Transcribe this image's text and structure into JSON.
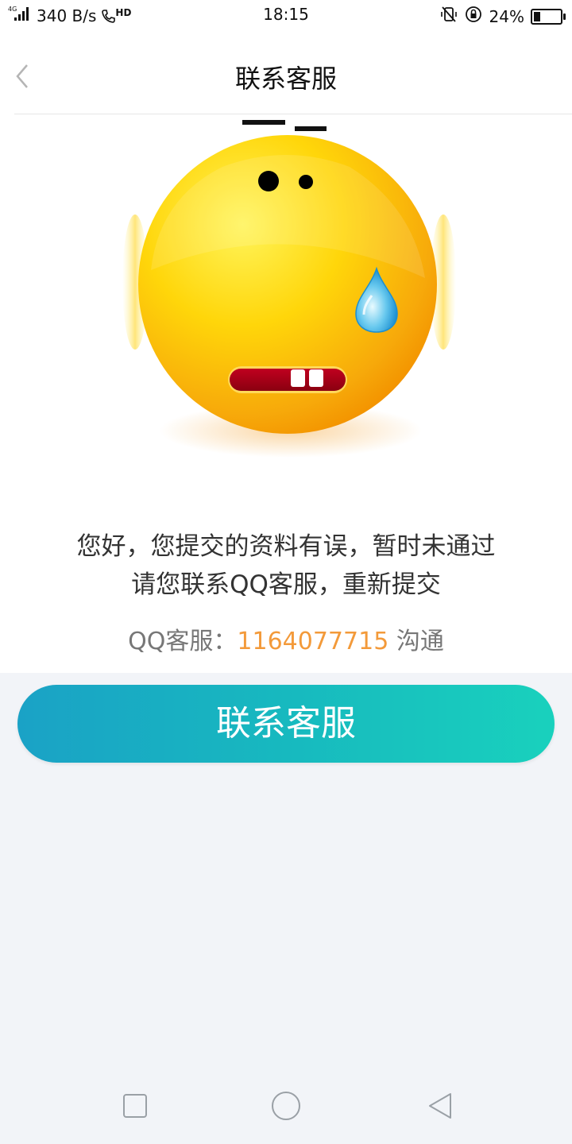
{
  "status_bar": {
    "network": "4G",
    "speed": "340 B/s",
    "hd": "HD",
    "time": "18:15",
    "battery": "24%",
    "battery_level": 0.24
  },
  "nav": {
    "title": "联系客服"
  },
  "message": {
    "line1": "您好，您提交的资料有误，暂时未通过",
    "line2": "请您联系QQ客服，重新提交"
  },
  "qq": {
    "label": "QQ客服：",
    "number": "1164077715",
    "suffix": " 沟通"
  },
  "button": {
    "label": "联系客服"
  },
  "colors": {
    "accent_orange": "#f39a3a",
    "button_gradient_start": "#1aa2c6",
    "button_gradient_end": "#19d1bd",
    "lower_background": "#f2f4f8"
  },
  "icons": {
    "back": "chevron-left-icon",
    "illustration": "sweating-face-emoji",
    "sys_recent": "square-icon",
    "sys_home": "circle-icon",
    "sys_back": "triangle-back-icon"
  }
}
